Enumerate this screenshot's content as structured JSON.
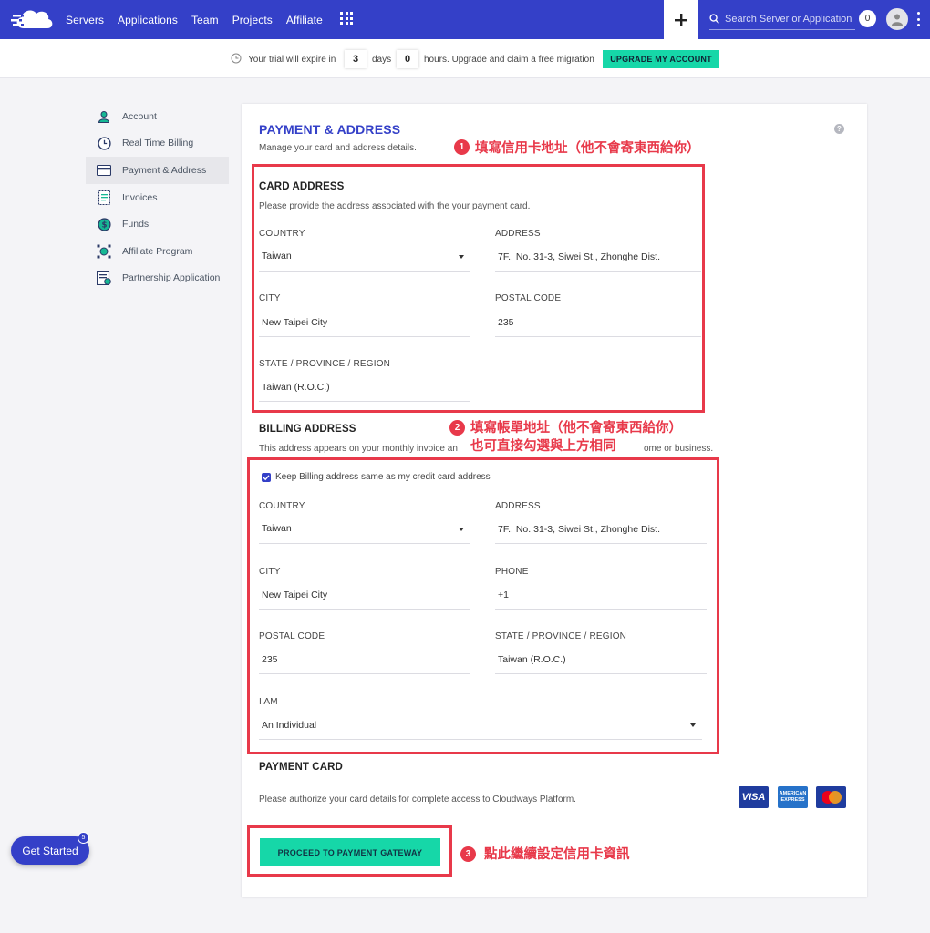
{
  "nav": {
    "items": [
      "Servers",
      "Applications",
      "Team",
      "Projects",
      "Affiliate"
    ],
    "search_placeholder": "Search Server or Application",
    "notification_count": "0"
  },
  "trial": {
    "prefix": "Your trial will expire in",
    "days_value": "3",
    "days_label": "days",
    "hours_value": "0",
    "hours_label": "hours. Upgrade and claim a free migration",
    "upgrade_label": "UPGRADE MY ACCOUNT"
  },
  "sidebar": {
    "items": [
      {
        "label": "Account",
        "icon": "user-icon"
      },
      {
        "label": "Real Time Billing",
        "icon": "clock-icon"
      },
      {
        "label": "Payment & Address",
        "icon": "credit-card-icon"
      },
      {
        "label": "Invoices",
        "icon": "invoice-icon"
      },
      {
        "label": "Funds",
        "icon": "dollar-icon"
      },
      {
        "label": "Affiliate Program",
        "icon": "affiliate-icon"
      },
      {
        "label": "Partnership Application",
        "icon": "partnership-icon"
      }
    ]
  },
  "page": {
    "title": "PAYMENT & ADDRESS",
    "subtitle": "Manage your card and address details."
  },
  "card_address": {
    "heading": "CARD ADDRESS",
    "description": "Please provide the address associated with the your payment card.",
    "country_label": "COUNTRY",
    "country_value": "Taiwan",
    "address_label": "ADDRESS",
    "address_value": "7F., No. 31-3, Siwei St., Zhonghe Dist.",
    "city_label": "CITY",
    "city_value": "New Taipei City",
    "postal_label": "POSTAL CODE",
    "postal_value": "235",
    "state_label": "STATE / PROVINCE / REGION",
    "state_value": "Taiwan (R.O.C.)"
  },
  "billing_address": {
    "heading": "BILLING ADDRESS",
    "description_left": "This address appears on your monthly invoice an",
    "description_right": "ome or business.",
    "keep_same_label": "Keep Billing address same as my credit card address",
    "country_label": "COUNTRY",
    "country_value": "Taiwan",
    "address_label": "ADDRESS",
    "address_value": "7F., No. 31-3, Siwei St., Zhonghe Dist.",
    "city_label": "CITY",
    "city_value": "New Taipei City",
    "phone_label": "PHONE",
    "phone_value": "+1",
    "postal_label": "POSTAL CODE",
    "postal_value": "235",
    "state_label": "STATE / PROVINCE / REGION",
    "state_value": "Taiwan (R.O.C.)",
    "iam_label": "I AM",
    "iam_value": "An Individual"
  },
  "payment_card": {
    "heading": "PAYMENT CARD",
    "description": "Please authorize your card details for complete access to Cloudways Platform.",
    "visa_label": "VISA",
    "amex_label_1": "AMERICAN",
    "amex_label_2": "EXPRESS",
    "proceed_label": "PROCEED TO PAYMENT GATEWAY"
  },
  "annotations": {
    "badge_1": "1",
    "text_1": "填寫信用卡地址（他不會寄東西給你）",
    "badge_2": "2",
    "text_2a": "填寫帳單地址（他不會寄東西給你）",
    "text_2b": "也可直接勾選與上方相同",
    "badge_3": "3",
    "text_3": "點此繼續設定信用卡資訊"
  },
  "get_started": {
    "label": "Get Started",
    "badge": "5"
  },
  "colors": {
    "brand": "#3440c8",
    "accent": "#16d7a8",
    "annotation": "#e8394a"
  }
}
